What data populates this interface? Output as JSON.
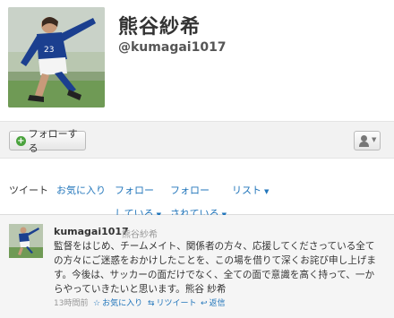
{
  "profile": {
    "display_name": "熊谷紗希",
    "screen_name": "@kumagai1017"
  },
  "actions": {
    "follow_label": "フォローする",
    "follow_icon": "plus-icon",
    "person_menu_icon": "person-icon"
  },
  "tabs": [
    {
      "line1": "ツイート",
      "line2": "",
      "dropdown": false
    },
    {
      "line1": "お気に入り",
      "line2": "",
      "dropdown": false
    },
    {
      "line1": "フォロー",
      "line2": "している",
      "dropdown": true
    },
    {
      "line1": "フォロー",
      "line2": "されている",
      "dropdown": true
    },
    {
      "line1": "リスト",
      "line2": "",
      "dropdown": true
    }
  ],
  "tweet": {
    "username": "kumagai1017",
    "fullname": "熊谷紗希",
    "lines": [
      "監督をはじめ、チームメイト、関係者の方々、応援してくださっている全て",
      "の方々にご迷惑をおかけしたことを、この場を借りて深くお詫び申し上げま",
      "す。今後は、サッカーの面だけでなく、全ての面で意識を高く持って、一か",
      "らやっていきたいと思います。熊谷 紗希"
    ],
    "time": "13時間前",
    "favorite_label": "お気に入り",
    "retweet_label": "リツイート",
    "reply_label": "返信"
  },
  "colors": {
    "link": "#2276bb",
    "follow_green": "#4ba33e",
    "uniform_blue": "#1b3f8f"
  }
}
